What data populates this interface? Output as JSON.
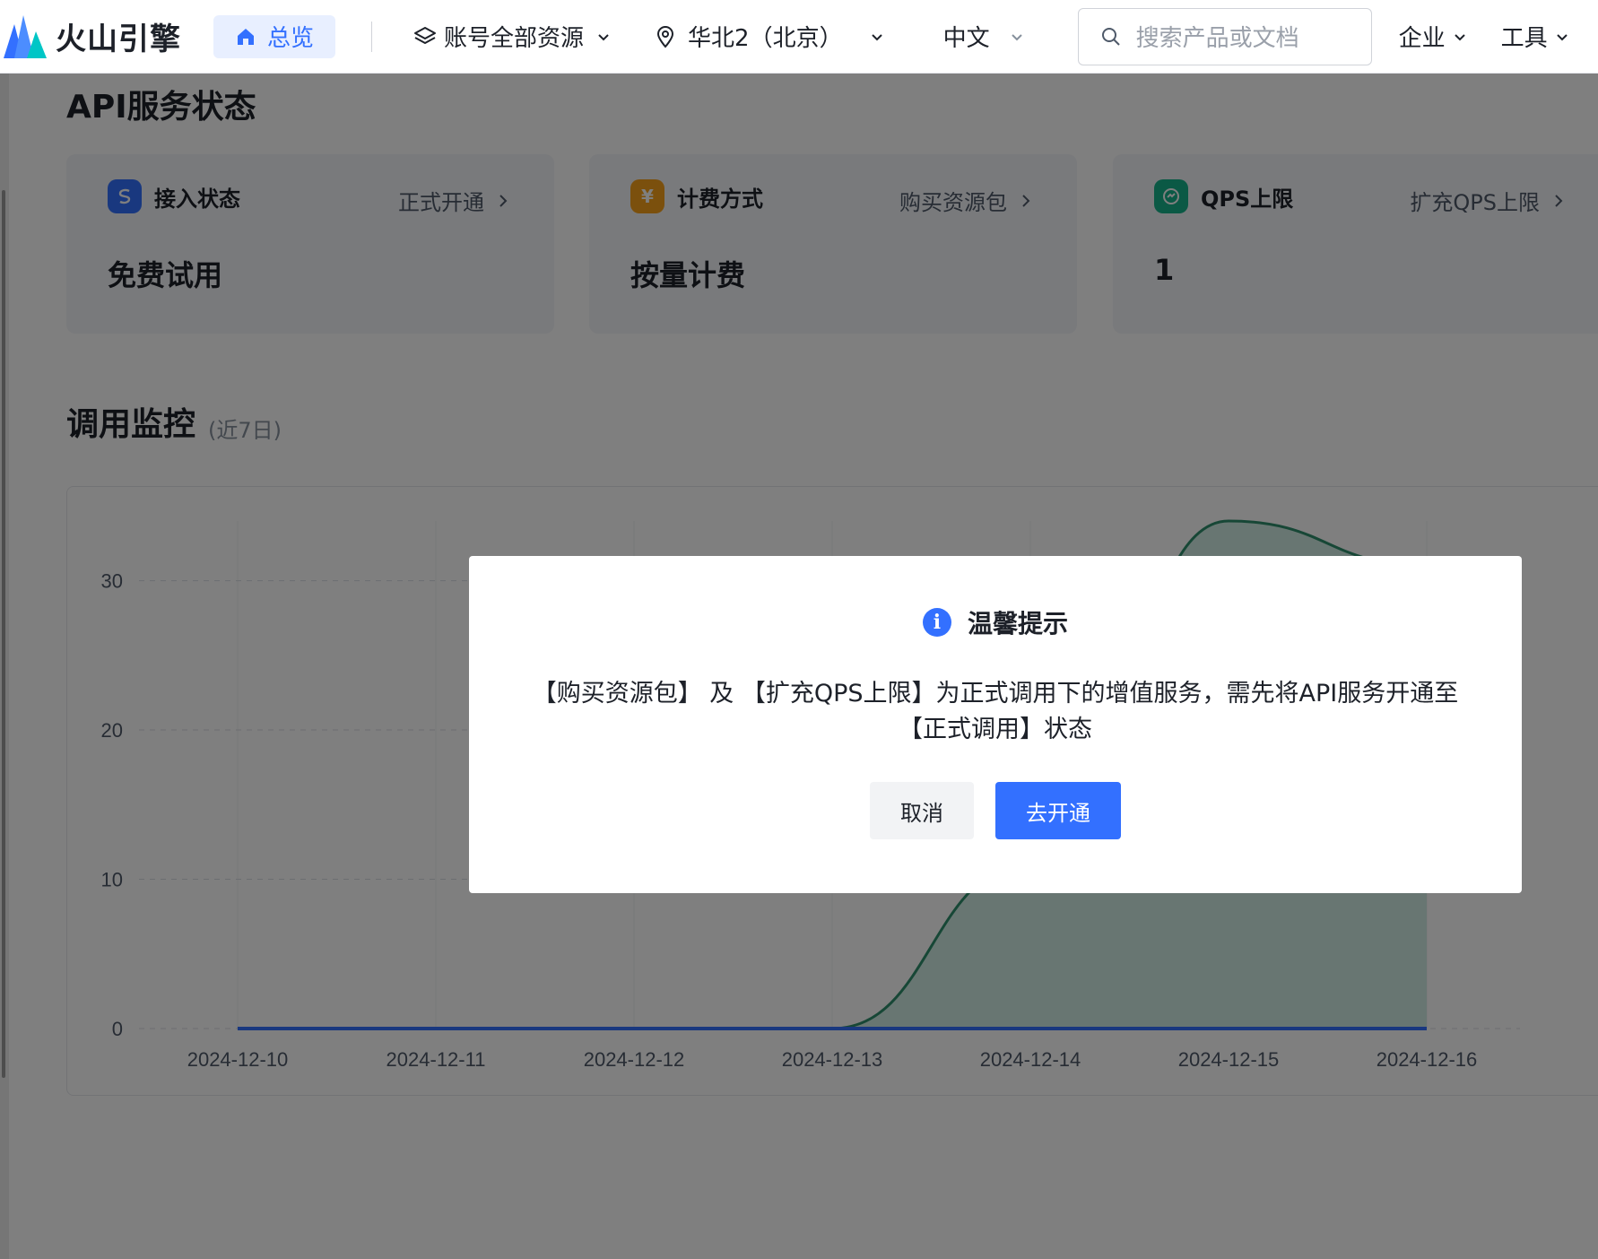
{
  "header": {
    "brand_name": "火山引擎",
    "home_label": "总览",
    "resources_label": "账号全部资源",
    "region_label": "华北2（北京）",
    "language_label": "中文",
    "search_placeholder": "搜索产品或文档",
    "enterprise_label": "企业",
    "tools_label": "工具"
  },
  "api_status": {
    "title": "API服务状态",
    "cards": [
      {
        "label": "接入状态",
        "link": "正式开通",
        "value": "免费试用",
        "icon": "access-icon"
      },
      {
        "label": "计费方式",
        "link": "购买资源包",
        "value": "按量计费",
        "icon": "yen-icon"
      },
      {
        "label": "QPS上限",
        "link": "扩充QPS上限",
        "value": "1",
        "icon": "qps-icon"
      }
    ]
  },
  "monitoring": {
    "title": "调用监控",
    "subtitle": "(近7日)"
  },
  "chart_data": {
    "type": "area",
    "x": [
      "2024-12-10",
      "2024-12-11",
      "2024-12-12",
      "2024-12-13",
      "2024-12-14",
      "2024-12-15",
      "2024-12-16"
    ],
    "y_ticks": [
      0,
      10,
      20,
      30
    ],
    "ylim": [
      0,
      34
    ],
    "grid": true,
    "series": [
      {
        "values": [
          0,
          0,
          0,
          0,
          11,
          34,
          31
        ],
        "color": "#2f8f6d"
      },
      {
        "values": [
          0,
          0,
          0,
          0,
          0,
          0,
          0
        ],
        "color": "#3370ff"
      }
    ]
  },
  "modal": {
    "title": "温馨提示",
    "message": "【购买资源包】 及 【扩充QPS上限】为正式调用下的增值服务，需先将API服务开通至【正式调用】状态",
    "cancel_label": "取消",
    "confirm_label": "去开通"
  },
  "colors": {
    "primary": "#3370ff",
    "area_line": "#2f8f6d",
    "area_fill": "#c8eadf"
  }
}
